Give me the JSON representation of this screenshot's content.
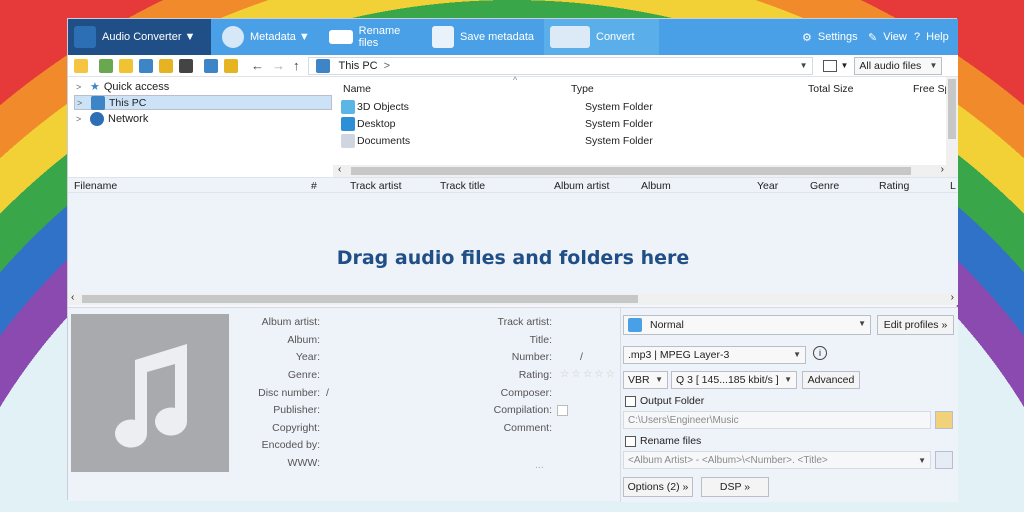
{
  "ribbon": {
    "audio_converter": "Audio Converter ▼",
    "metadata": "Metadata ▼",
    "rename_files": "Rename files",
    "save_metadata": "Save metadata",
    "convert": "Convert",
    "settings": "Settings",
    "view": "View",
    "help": "Help"
  },
  "address": {
    "location": "This PC",
    "sep": ">",
    "filter": "All audio files"
  },
  "tree": {
    "items": [
      {
        "label": "Quick access"
      },
      {
        "label": "This PC"
      },
      {
        "label": "Network"
      }
    ]
  },
  "browser": {
    "headers": [
      "Name",
      "Type",
      "Total Size",
      "Free Sp"
    ],
    "rows": [
      {
        "name": "3D Objects",
        "type": "System Folder"
      },
      {
        "name": "Desktop",
        "type": "System Folder"
      },
      {
        "name": "Documents",
        "type": "System Folder"
      }
    ]
  },
  "columns": [
    "Filename",
    "#",
    "Track artist",
    "Track title",
    "Album artist",
    "Album",
    "Year",
    "Genre",
    "Rating",
    "L"
  ],
  "drop_message": "Drag audio files and folders here",
  "tag_fields_left": [
    "Album artist:",
    "Album:",
    "Year:",
    "Genre:",
    "Disc number:",
    "Publisher:",
    "Copyright:",
    "Encoded by:",
    "WWW:"
  ],
  "tag_fields_right": [
    "Track artist:",
    "Title:",
    "Number:",
    "Rating:",
    "Composer:",
    "Compilation:",
    "Comment:"
  ],
  "slash": "/",
  "ellipsis": "...",
  "converter": {
    "profile": "Normal",
    "edit_profiles": "Edit profiles »",
    "format": ".mp3 | MPEG Layer-3",
    "mode": "VBR",
    "quality": "Q 3  [ 145...185 kbit/s ]",
    "advanced": "Advanced",
    "output_folder_label": "Output Folder",
    "output_folder_path": "C:\\Users\\Engineer\\Music",
    "rename_label": "Rename files",
    "rename_pattern": "<Album Artist> - <Album>\\<Number>. <Title>",
    "options": "Options (2) »",
    "dsp": "DSP »"
  },
  "colors": {
    "ribbon": "#4aa0e6",
    "ribbon_dark": "#1f4f86",
    "drop_text": "#1f4f86"
  }
}
